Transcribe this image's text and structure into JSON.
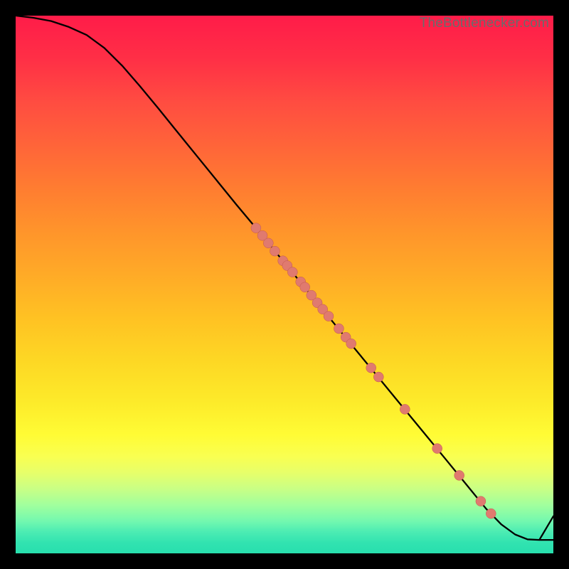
{
  "watermark": "TheBottlenecker.com",
  "colors": {
    "line": "#000000",
    "point_fill": "#e07a6f",
    "point_stroke": "#c2574d"
  },
  "chart_data": {
    "type": "line",
    "title": "",
    "xlabel": "",
    "ylabel": "",
    "xlim": [
      0,
      100
    ],
    "ylim": [
      0,
      100
    ],
    "grid": false,
    "legend": false,
    "axes_visible": false,
    "note": "Axis values are normalized 0–100 estimated from pixel positions; no numeric tick labels are rendered in the source image.",
    "series": [
      {
        "name": "curve",
        "kind": "line",
        "x": [
          0.0,
          3.3,
          6.6,
          9.9,
          13.2,
          16.5,
          19.8,
          23.1,
          26.5,
          29.8,
          33.7,
          37.6,
          41.1,
          44.7,
          48.8,
          52.9,
          56.9,
          60.9,
          66.0,
          71.1,
          75.7,
          80.3,
          83.9,
          87.5,
          90.3,
          92.9,
          95.2,
          97.4,
          100.0
        ],
        "y": [
          100.0,
          99.6,
          99.0,
          97.9,
          96.4,
          94.0,
          90.7,
          86.9,
          82.8,
          78.7,
          73.9,
          69.1,
          64.8,
          60.5,
          55.5,
          50.5,
          45.6,
          40.7,
          34.5,
          28.3,
          22.7,
          17.1,
          12.7,
          8.3,
          5.4,
          3.5,
          2.6,
          2.5,
          2.5
        ]
      },
      {
        "name": "tail-rise",
        "kind": "line",
        "x": [
          97.4,
          100.0
        ],
        "y": [
          2.5,
          6.9
        ]
      },
      {
        "name": "points",
        "kind": "scatter",
        "x": [
          44.7,
          45.9,
          47.0,
          48.2,
          49.7,
          50.5,
          51.5,
          53.0,
          53.8,
          55.0,
          56.1,
          57.1,
          58.2,
          60.1,
          61.4,
          62.4,
          66.1,
          67.5,
          72.4,
          78.4,
          82.5,
          86.5,
          88.4
        ],
        "y": [
          60.5,
          59.1,
          57.7,
          56.2,
          54.4,
          53.5,
          52.3,
          50.5,
          49.5,
          48.0,
          46.6,
          45.4,
          44.1,
          41.8,
          40.2,
          39.0,
          34.5,
          32.8,
          26.8,
          19.5,
          14.5,
          9.7,
          7.4
        ]
      }
    ]
  }
}
